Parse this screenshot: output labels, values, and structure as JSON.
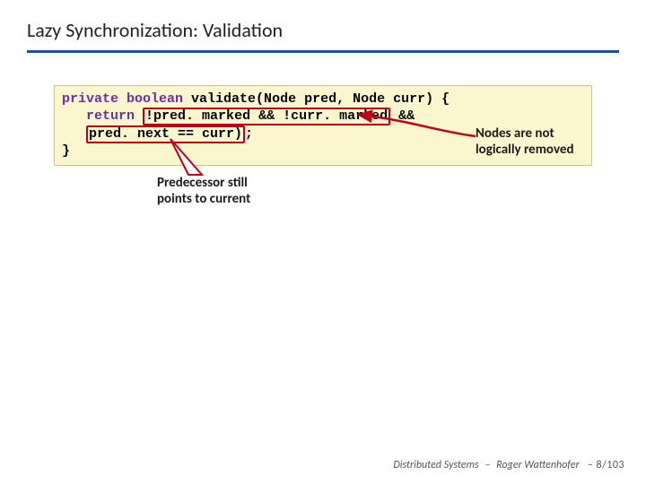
{
  "title": "Lazy Synchronization: Validation",
  "code": {
    "kw_private": "private",
    "kw_boolean": "boolean",
    "fn_decl": " validate(Node pred, Node curr) {",
    "indent": "   ",
    "kw_return": "return",
    "seg_space": " ",
    "hl_marked": "!pred. marked && !curr. marked",
    "seg_after_marked": " &&",
    "hl_next": "pred. next == curr)",
    "seg_after_next": ";",
    "close": "}"
  },
  "annot_right_l1": "Nodes are not",
  "annot_right_l2": "logically removed",
  "annot_below_l1": "Predecessor still",
  "annot_below_l2": "points to current",
  "footer_course": "Distributed Systems",
  "footer_author": "Roger Wattenhofer",
  "footer_page": "– 8/103"
}
